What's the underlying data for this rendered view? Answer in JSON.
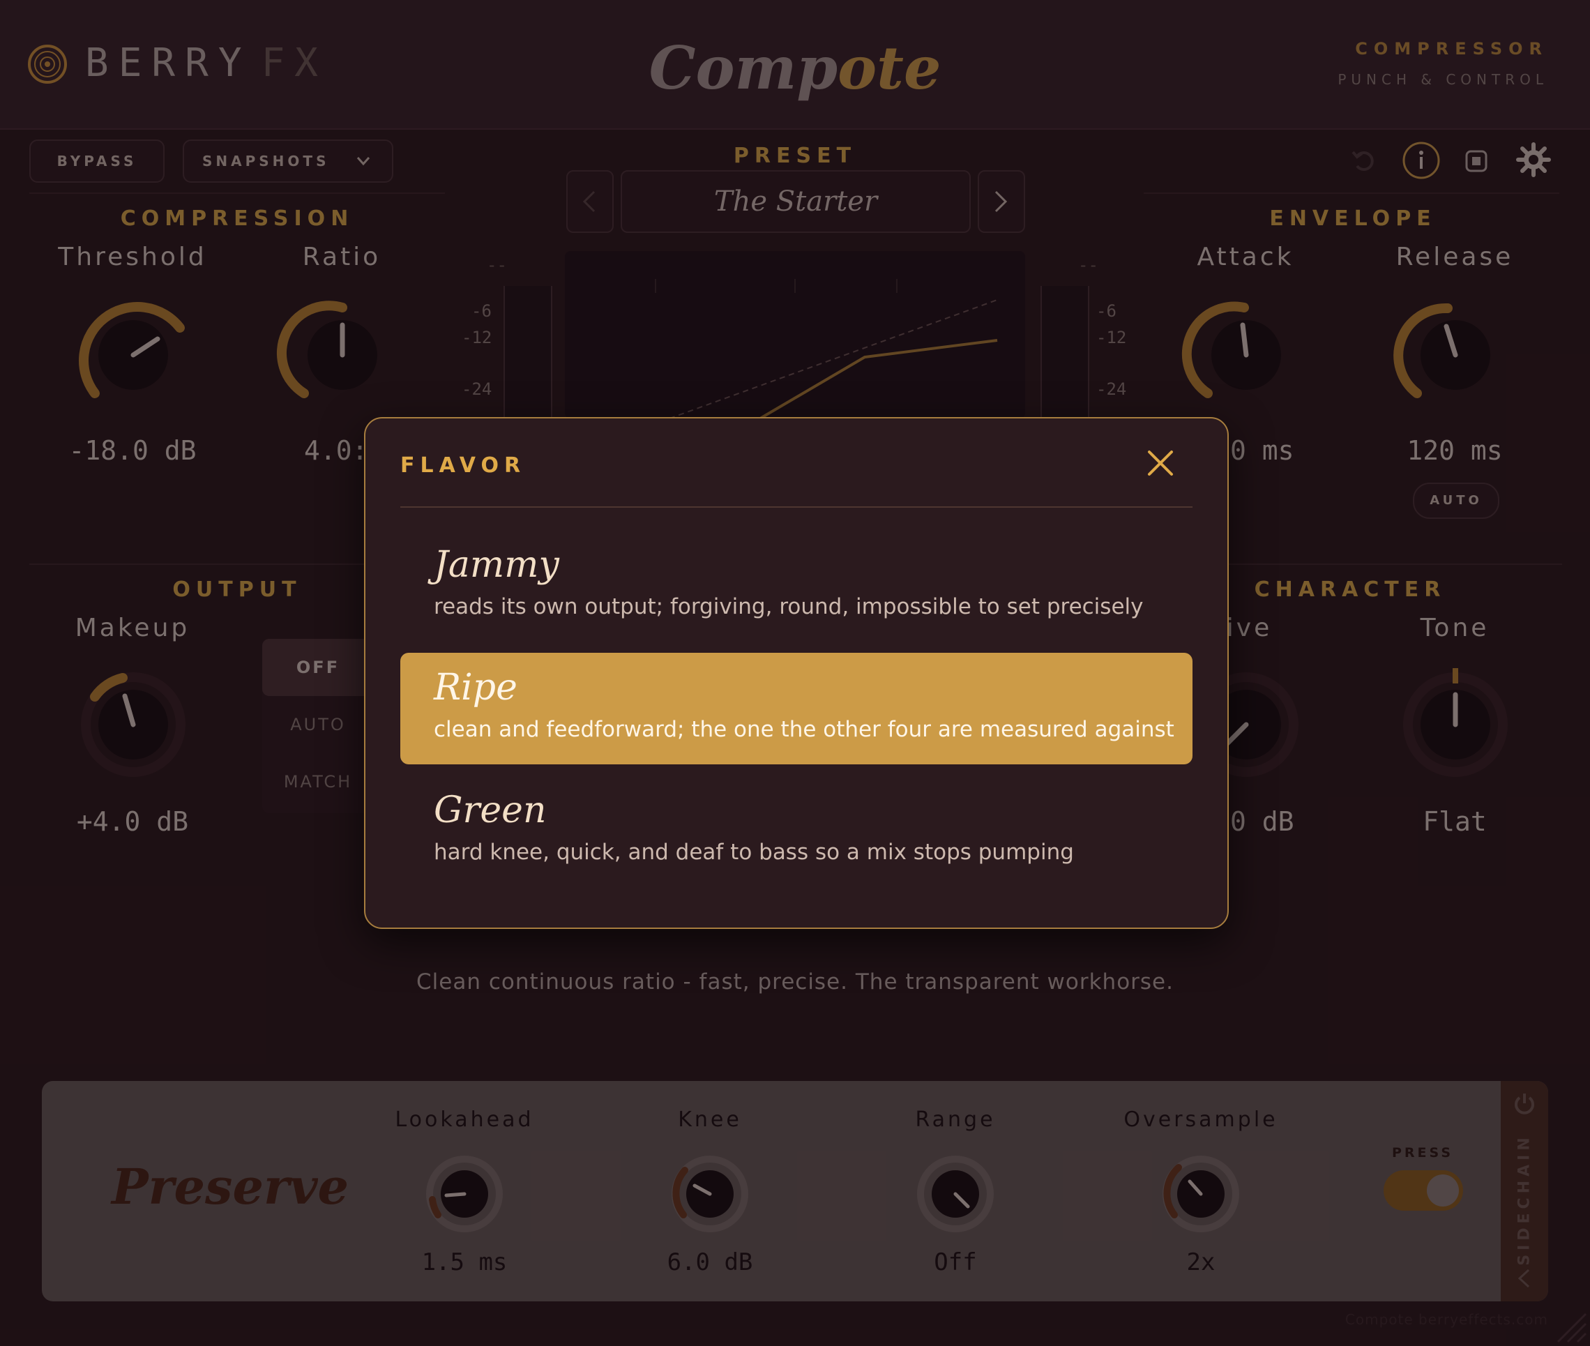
{
  "header": {
    "brand_a": "BERRY",
    "brand_b": "FX",
    "title_a": "Comp",
    "title_b": "ote",
    "type": "COMPRESSOR",
    "tagline": "PUNCH & CONTROL"
  },
  "toolbar": {
    "bypass": "BYPASS",
    "snapshots": "SNAPSHOTS"
  },
  "preset": {
    "label": "PRESET",
    "name": "The Starter"
  },
  "compression": {
    "title": "COMPRESSION",
    "threshold_label": "Threshold",
    "threshold_value": "-18.0 dB",
    "ratio_label": "Ratio",
    "ratio_value": "4.0:"
  },
  "envelope": {
    "title": "ENVELOPE",
    "attack_label": "Attack",
    "attack_value": "0 ms",
    "release_label": "Release",
    "release_value": "120 ms",
    "auto": "AUTO"
  },
  "meters": {
    "left_top": "--",
    "right_top": "--",
    "ticks": [
      "-6",
      "-12",
      "-24"
    ]
  },
  "output": {
    "title": "OUTPUT",
    "makeup_label": "Makeup",
    "makeup_value": "+4.0 dB",
    "modes": [
      "OFF",
      "AUTO",
      "MATCH"
    ]
  },
  "character": {
    "title": "CHARACTER",
    "drive_label": "rive",
    "drive_value": "0 dB",
    "tone_label": "Tone",
    "tone_value": "Flat"
  },
  "description": "Clean continuous ratio - fast, precise. The transparent workhorse.",
  "modal": {
    "title": "FLAVOR",
    "options": [
      {
        "name": "Jammy",
        "desc": "reads its own output; forgiving, round, impossible to set precisely"
      },
      {
        "name": "Ripe",
        "desc": "clean and feedforward; the one the other four are measured against"
      },
      {
        "name": "Green",
        "desc": "hard knee, quick, and deaf to bass so a mix stops pumping"
      }
    ],
    "selected": "Ripe"
  },
  "bottom": {
    "mode_name": "Preserve",
    "lookahead_label": "Lookahead",
    "lookahead_value": "1.5 ms",
    "knee_label": "Knee",
    "knee_value": "6.0 dB",
    "range_label": "Range",
    "range_value": "Off",
    "oversample_label": "Oversample",
    "oversample_value": "2x",
    "press_label": "PRESS",
    "sidechain_label": "SIDECHAIN"
  },
  "footer": "Compote  berryeffects.com",
  "colors": {
    "accent": "#d7a64a",
    "background": "#2d1a1e",
    "selected_option": "#cc9b47"
  }
}
